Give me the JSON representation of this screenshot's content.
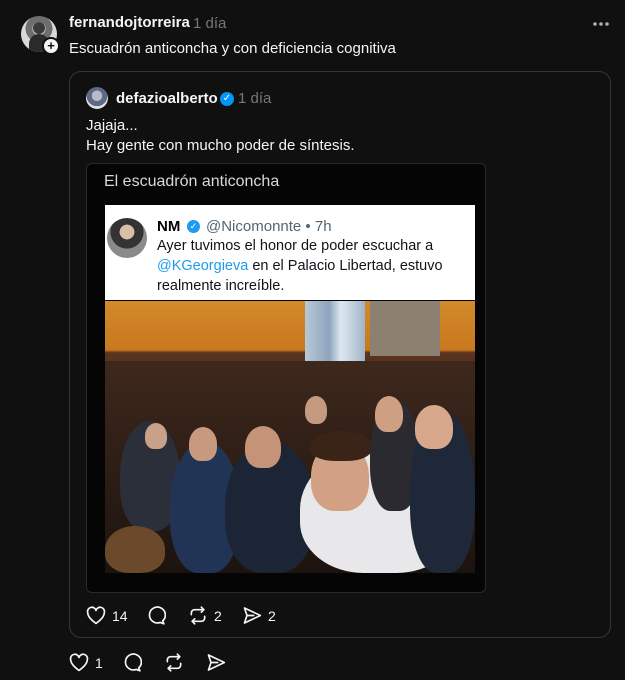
{
  "post": {
    "username": "fernandojtorreira",
    "time": "1 día",
    "text": "Escuadrón anticoncha y con deficiencia cognitiva",
    "likes": "1"
  },
  "quote": {
    "username": "defazioalberto",
    "time": "1 día",
    "line1": "Jajaja...",
    "line2": "Hay gente con mucho poder de síntesis.",
    "likes": "14",
    "reposts": "2",
    "shares": "2"
  },
  "image": {
    "caption": "El escuadrón anticoncha",
    "tweet_name": "NM",
    "tweet_handle_time": "@Nicomonnte • 7h",
    "tweet_line1": "Ayer tuvimos el honor de poder escuchar a",
    "tweet_mention": "@KGeorgieva",
    "tweet_line2_rest": " en el Palacio Libertad, estuvo",
    "tweet_line3": "realmente increíble."
  },
  "colors": {
    "background": "#101010",
    "verified": "#0095f6",
    "mention": "#1d9bf0",
    "muted": "#777777"
  }
}
